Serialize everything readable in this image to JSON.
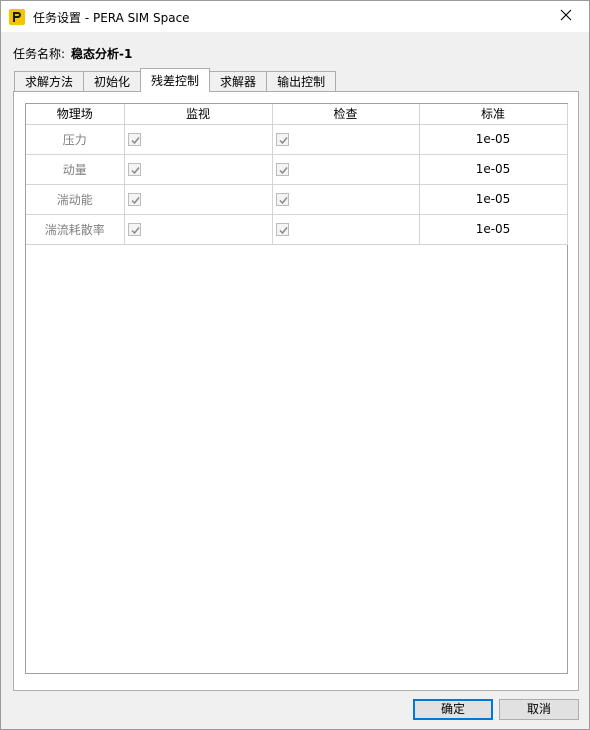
{
  "window": {
    "title": "任务设置 - PERA SIM Space",
    "icons": {
      "app": "pera-logo-icon",
      "close": "close-icon"
    }
  },
  "task": {
    "label": "任务名称:",
    "name": "稳态分析-1"
  },
  "tabs": [
    {
      "label": "求解方法",
      "active": false
    },
    {
      "label": "初始化",
      "active": false
    },
    {
      "label": "残差控制",
      "active": true
    },
    {
      "label": "求解器",
      "active": false
    },
    {
      "label": "输出控制",
      "active": false
    }
  ],
  "table": {
    "headers": [
      "物理场",
      "监视",
      "检查",
      "标准"
    ],
    "rows": [
      {
        "field": "压力",
        "monitor": true,
        "check": true,
        "criterion": "1e-05"
      },
      {
        "field": "动量",
        "monitor": true,
        "check": true,
        "criterion": "1e-05"
      },
      {
        "field": "湍动能",
        "monitor": true,
        "check": true,
        "criterion": "1e-05"
      },
      {
        "field": "湍流耗散率",
        "monitor": true,
        "check": true,
        "criterion": "1e-05"
      }
    ]
  },
  "buttons": {
    "ok": "确定",
    "cancel": "取消"
  },
  "colors": {
    "accent": "#0078d7",
    "logo_bg": "#f5c400"
  }
}
